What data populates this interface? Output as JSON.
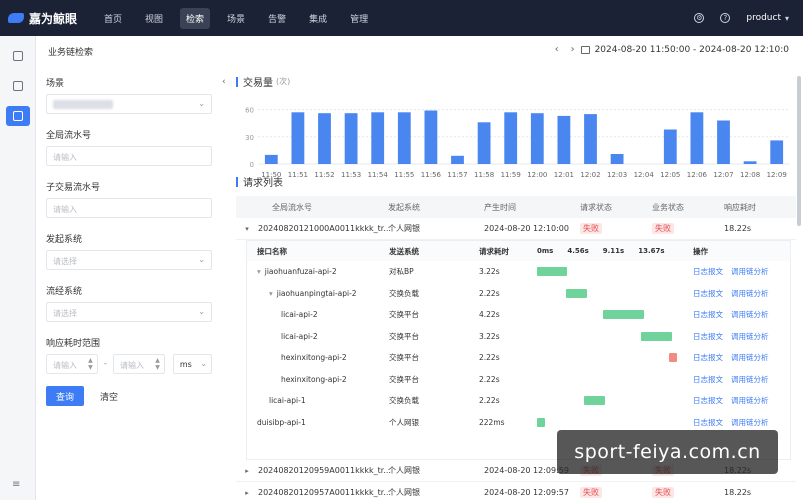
{
  "app": {
    "logo_text": "嘉为鲸眼"
  },
  "nav": [
    "首页",
    "视图",
    "检索",
    "场景",
    "告警",
    "集成",
    "管理"
  ],
  "nav_active_index": 2,
  "user": {
    "name": "product"
  },
  "filters": {
    "title": "业务链检索",
    "scene_label": "场景",
    "global_no_label": "全局流水号",
    "global_no_placeholder": "请输入",
    "sub_no_label": "子交易流水号",
    "sub_no_placeholder": "请输入",
    "origin_label": "发起系统",
    "origin_placeholder": "请选择",
    "flow_label": "流经系统",
    "flow_placeholder": "请选择",
    "resp_label": "响应耗时范围",
    "resp_min_placeholder": "请输入",
    "resp_max_placeholder": "请输入",
    "range_sep": "-",
    "unit": "ms",
    "query_btn": "查询",
    "clear_btn": "清空"
  },
  "date_range": "2024-08-20 11:50:00 - 2024-08-20 12:10:0",
  "volume": {
    "title": "交易量",
    "unit": "(次)",
    "y_ticks": [
      "0",
      "30",
      "60"
    ]
  },
  "chart_data": {
    "type": "bar",
    "categories": [
      "11:50",
      "11:51",
      "11:52",
      "11:53",
      "11:54",
      "11:55",
      "11:56",
      "11:57",
      "11:58",
      "11:59",
      "12:00",
      "12:01",
      "12:02",
      "12:03",
      "12:04",
      "12:05",
      "12:06",
      "12:07",
      "12:08",
      "12:09"
    ],
    "values": [
      10,
      57,
      56,
      56,
      57,
      57,
      59,
      9,
      46,
      57,
      56,
      53,
      55,
      11,
      0,
      38,
      57,
      48,
      3,
      26
    ],
    "title": "交易量",
    "xlabel": "",
    "ylabel": "",
    "ylim": [
      0,
      75
    ],
    "color": "#4a86f0",
    "grid": true
  },
  "request_list": {
    "title": "请求列表",
    "columns": [
      "全局流水号",
      "发起系统",
      "产生时间",
      "请求状态",
      "业务状态",
      "响应耗时"
    ],
    "rows": [
      {
        "id": "20240820121000A0011kkkk_tr...",
        "sys": "个人网银",
        "time": "2024-08-20 12:10:00",
        "req": "失败",
        "biz": "失败",
        "dur": "18.22s",
        "expanded": true
      },
      {
        "id": "20240820120959A0011kkkk_tr...",
        "sys": "个人网银",
        "time": "2024-08-20 12:09:59",
        "req": "失败",
        "biz": "失败",
        "dur": "18.22s",
        "expanded": false
      },
      {
        "id": "20240820120957A0011kkkk_tr...",
        "sys": "个人网银",
        "time": "2024-08-20 12:09:57",
        "req": "失败",
        "biz": "失败",
        "dur": "18.22s",
        "expanded": false
      }
    ]
  },
  "detail": {
    "columns": [
      "接口名称",
      "发送系统",
      "请求耗时"
    ],
    "ticks": [
      "0ms",
      "4.56s",
      "9.11s",
      "13.67s"
    ],
    "ops_label": "操作",
    "op_log": "日志报文",
    "op_chain": "调用链分析",
    "rows": [
      {
        "name": "jiaohuanfuzai-api-2",
        "indent": 1,
        "toggle": "▾",
        "sys": "对私BP",
        "dur": "3.22s",
        "start": 0.0,
        "len": 0.2,
        "color": "green"
      },
      {
        "name": "jiaohuanpingtai-api-2",
        "indent": 2,
        "toggle": "▾",
        "sys": "交换负载",
        "dur": "2.22s",
        "start": 0.19,
        "len": 0.14,
        "color": "green"
      },
      {
        "name": "licai-api-2",
        "indent": 3,
        "toggle": "",
        "sys": "交换平台",
        "dur": "4.22s",
        "start": 0.44,
        "len": 0.27,
        "color": "green"
      },
      {
        "name": "licai-api-2",
        "indent": 3,
        "toggle": "",
        "sys": "交换平台",
        "dur": "3.22s",
        "start": 0.69,
        "len": 0.21,
        "color": "green"
      },
      {
        "name": "hexinxitong-api-2",
        "indent": 3,
        "toggle": "",
        "sys": "交换平台",
        "dur": "2.22s",
        "start": 0.88,
        "len": 0.05,
        "color": "red"
      },
      {
        "name": "hexinxitong-api-2",
        "indent": 3,
        "toggle": "",
        "sys": "交换平台",
        "dur": "2.22s",
        "start": 0.0,
        "len": 0.0,
        "color": "none"
      },
      {
        "name": "licai-api-1",
        "indent": 2,
        "toggle": "",
        "sys": "交换负载",
        "dur": "2.22s",
        "start": 0.31,
        "len": 0.14,
        "color": "green"
      },
      {
        "name": "duisibp-api-1",
        "indent": 1,
        "toggle": "",
        "sys": "个人网银",
        "dur": "222ms",
        "start": 0.0,
        "len": 0.05,
        "color": "green"
      }
    ]
  },
  "watermark": "sport-feiya.com.cn"
}
